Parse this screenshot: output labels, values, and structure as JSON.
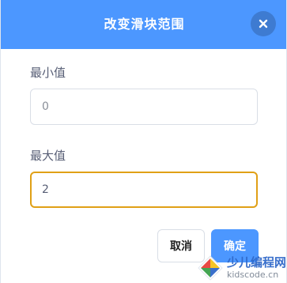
{
  "dialog": {
    "title": "改变滑块范围",
    "close_icon": "close-icon",
    "min": {
      "label": "最小值",
      "value": "0"
    },
    "max": {
      "label": "最大值",
      "value": "2"
    },
    "buttons": {
      "cancel_label": "取消",
      "ok_label": "确定"
    }
  },
  "watermark": {
    "name": "少儿编程网",
    "url": "kidscode.cn"
  },
  "colors": {
    "title_bar": "#4c97ff",
    "ok_button": "#4c97ff",
    "focus_border": "#e0a016",
    "label_text": "#575e75"
  }
}
